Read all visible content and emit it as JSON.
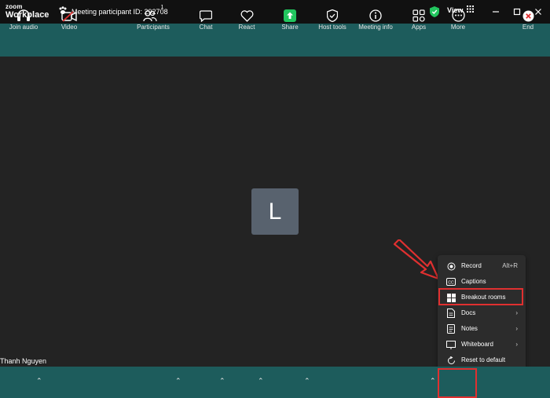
{
  "app": {
    "logo_top": "zoom",
    "logo_bottom": "Workplace"
  },
  "header": {
    "meeting_id": "Meeting participant ID: 292708",
    "view_label": "View"
  },
  "stage": {
    "avatar_letter": "L",
    "participant_name": "Thanh Nguyen"
  },
  "toolbar": {
    "join_audio": "Join audio",
    "video": "Video",
    "participants": "Participants",
    "participants_count": "1",
    "chat": "Chat",
    "react": "React",
    "share": "Share",
    "host_tools": "Host tools",
    "meeting_info": "Meeting info",
    "apps": "Apps",
    "more": "More",
    "end": "End"
  },
  "more_menu": {
    "record": "Record",
    "record_shortcut": "Alt+R",
    "captions": "Captions",
    "breakout_rooms": "Breakout rooms",
    "docs": "Docs",
    "notes": "Notes",
    "whiteboard": "Whiteboard",
    "reset": "Reset to default"
  },
  "colors": {
    "toolbar_bg": "#1d5c5c",
    "highlight": "#e03030",
    "share_green": "#22c55e",
    "shield_green": "#22c55e"
  }
}
